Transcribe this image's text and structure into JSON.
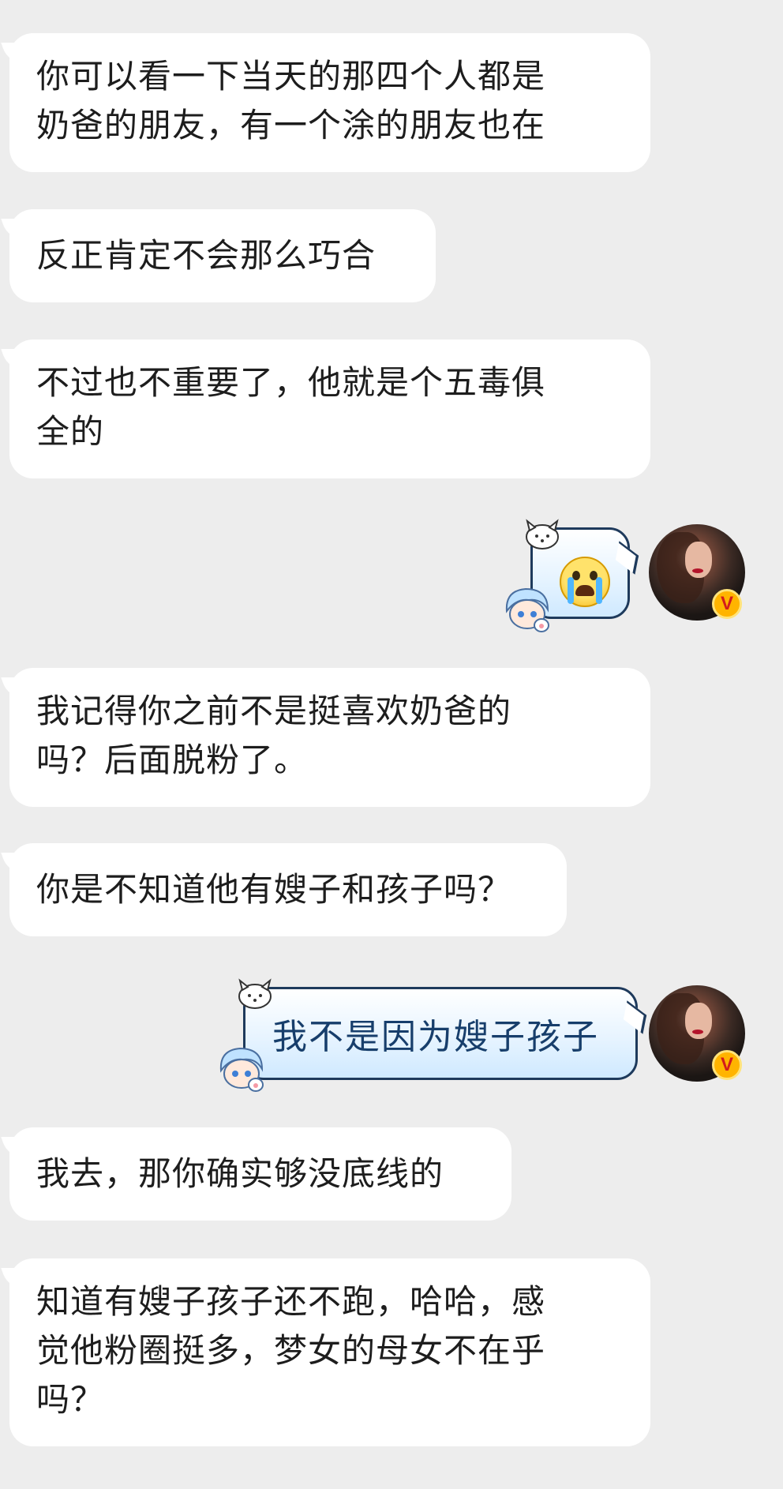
{
  "messages": [
    {
      "side": "in",
      "lines": [
        "你可以看一下当天的那四个人都是",
        "奶爸的朋友，有一个涂的朋友也在"
      ]
    },
    {
      "side": "in",
      "lines": [
        "反正肯定不会那么巧合"
      ]
    },
    {
      "side": "in",
      "lines": [
        "不过也不重要了，他就是个五毒俱",
        "全的"
      ]
    },
    {
      "side": "out",
      "type": "emoji",
      "emoji": "crying-emoji"
    },
    {
      "side": "in",
      "lines": [
        "我记得你之前不是挺喜欢奶爸的",
        "吗？后面脱粉了。"
      ]
    },
    {
      "side": "in",
      "lines": [
        "你是不知道他有嫂子和孩子吗？"
      ]
    },
    {
      "side": "out",
      "type": "text",
      "text": "我不是因为嫂子孩子"
    },
    {
      "side": "in",
      "lines": [
        "我去，那你确实够没底线的"
      ]
    },
    {
      "side": "in",
      "lines": [
        "知道有嫂子孩子还不跑，哈哈，感",
        "觉他粉圈挺多，梦女的母女不在乎",
        "吗？"
      ]
    }
  ],
  "avatar": {
    "badge": "V"
  },
  "colors": {
    "background": "#ededed",
    "incoming_bubble": "#ffffff",
    "outgoing_border": "#1e3a5c",
    "outgoing_text": "#173e6b",
    "badge": "#ffb400"
  }
}
